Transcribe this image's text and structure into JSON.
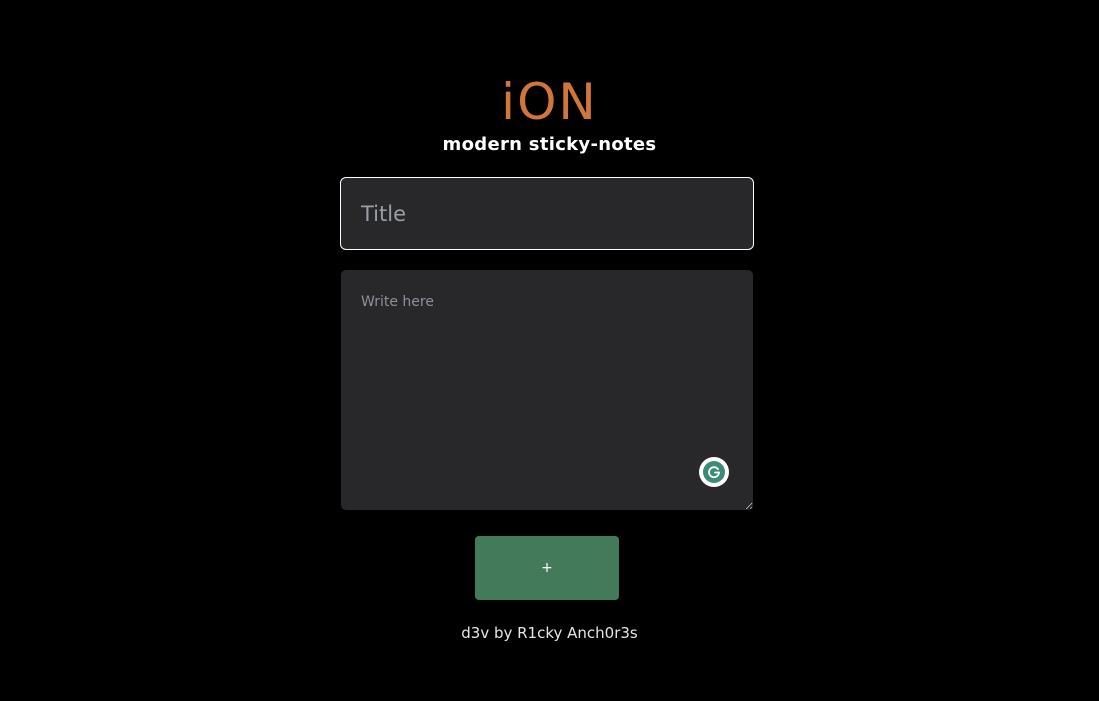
{
  "header": {
    "logo": "iON",
    "tagline": "modern sticky-notes"
  },
  "form": {
    "title_placeholder": "Title",
    "body_placeholder": "Write here",
    "add_button_label": "+"
  },
  "footer": {
    "credit": "d3v by R1cky Anch0r3s"
  },
  "colors": {
    "background": "#000000",
    "logo": "#d0763a",
    "field_bg": "#28282b",
    "button": "#437a59"
  },
  "icons": {
    "grammar_badge": "grammarly-icon"
  }
}
